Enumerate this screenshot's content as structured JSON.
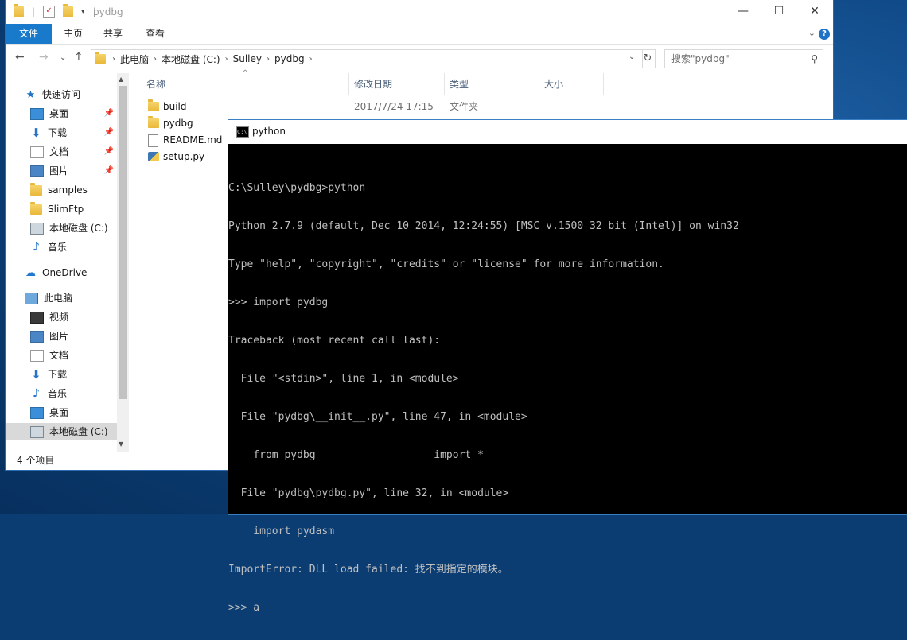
{
  "explorer": {
    "title": "pydbg",
    "controls": {
      "minimize": "—",
      "maximize": "☐",
      "close": "✕"
    },
    "ribbon_tabs": [
      "文件",
      "主页",
      "共享",
      "查看"
    ],
    "help": "?",
    "breadcrumb": [
      "此电脑",
      "本地磁盘 (C:)",
      "Sulley",
      "pydbg"
    ],
    "search_placeholder": "搜索\"pydbg\"",
    "sidebar": [
      {
        "label": "快速访问",
        "icon": "star-icon",
        "pinned": false
      },
      {
        "label": "桌面",
        "icon": "desktop-icon",
        "pinned": true
      },
      {
        "label": "下载",
        "icon": "download-icon",
        "pinned": true
      },
      {
        "label": "文档",
        "icon": "document-icon",
        "pinned": true
      },
      {
        "label": "图片",
        "icon": "pictures-icon",
        "pinned": true
      },
      {
        "label": "samples",
        "icon": "folder-icon",
        "pinned": false
      },
      {
        "label": "SlimFtp",
        "icon": "folder-icon",
        "pinned": false
      },
      {
        "label": "本地磁盘 (C:)",
        "icon": "drive-icon",
        "pinned": false
      },
      {
        "label": "音乐",
        "icon": "music-icon",
        "pinned": false
      },
      {
        "label": "OneDrive",
        "icon": "onedrive-icon",
        "pinned": false
      },
      {
        "label": "此电脑",
        "icon": "computer-icon",
        "pinned": false
      },
      {
        "label": "视频",
        "icon": "video-icon",
        "pinned": false
      },
      {
        "label": "图片",
        "icon": "pictures-icon",
        "pinned": false
      },
      {
        "label": "文档",
        "icon": "document-icon",
        "pinned": false
      },
      {
        "label": "下载",
        "icon": "download-icon",
        "pinned": false
      },
      {
        "label": "音乐",
        "icon": "music-icon",
        "pinned": false
      },
      {
        "label": "桌面",
        "icon": "desktop-icon",
        "pinned": false
      },
      {
        "label": "本地磁盘 (C:)",
        "icon": "drive-icon",
        "pinned": false,
        "selected": true
      }
    ],
    "columns": {
      "name": "名称",
      "date": "修改日期",
      "type": "类型",
      "size": "大小"
    },
    "files": [
      {
        "name": "build",
        "date": "2017/7/24 17:15",
        "type": "文件夹",
        "icon": "folder-icon"
      },
      {
        "name": "pydbg",
        "date": "",
        "type": "",
        "icon": "folder-icon"
      },
      {
        "name": "README.md",
        "date": "",
        "type": "",
        "icon": "file-icon"
      },
      {
        "name": "setup.py",
        "date": "",
        "type": "",
        "icon": "python-file-icon"
      }
    ],
    "status": "4 个项目"
  },
  "console": {
    "title": "python",
    "lines": [
      "C:\\Sulley\\pydbg>python",
      "Python 2.7.9 (default, Dec 10 2014, 12:24:55) [MSC v.1500 32 bit (Intel)] on win32",
      "Type \"help\", \"copyright\", \"credits\" or \"license\" for more information.",
      ">>> import pydbg",
      "Traceback (most recent call last):",
      "  File \"<stdin>\", line 1, in <module>",
      "  File \"pydbg\\__init__.py\", line 47, in <module>",
      "    from pydbg                   import *",
      "  File \"pydbg\\pydbg.py\", line 32, in <module>",
      "    import pydasm",
      "ImportError: DLL load failed: 找不到指定的模块。",
      ">>> a"
    ]
  }
}
